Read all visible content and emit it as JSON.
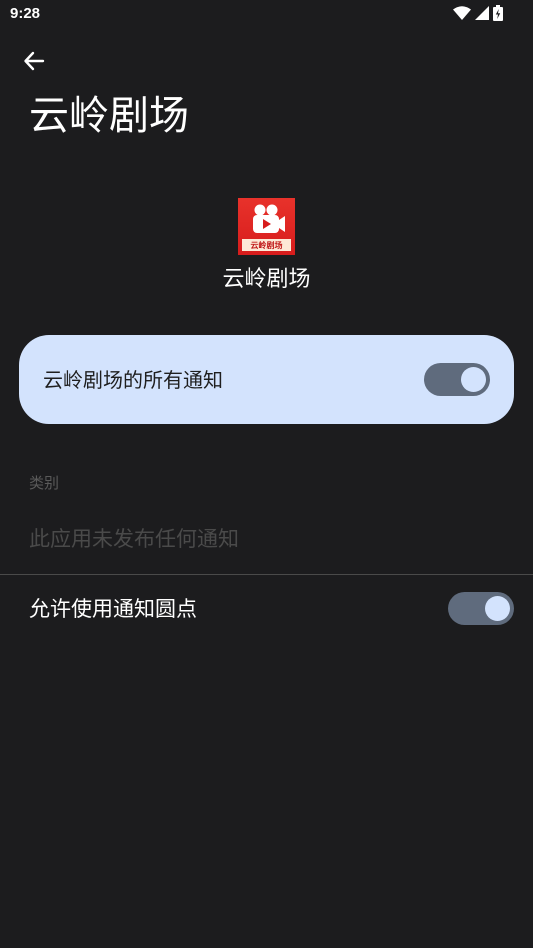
{
  "status_bar": {
    "time": "9:28",
    "icons": [
      "wifi-icon",
      "signal-icon",
      "battery-charging-icon"
    ]
  },
  "header": {
    "back_icon": "arrow-back-icon",
    "title": "云岭剧场"
  },
  "app": {
    "name": "云岭剧场",
    "icon_text": "云岭剧场",
    "icon_colors": {
      "background": "#d71c1c",
      "banner": "#fde9d6"
    }
  },
  "master_toggle": {
    "label": "云岭剧场的所有通知",
    "state": "on"
  },
  "categories": {
    "section_label": "类别",
    "empty_message": "此应用未发布任何通知"
  },
  "dots_toggle": {
    "label": "允许使用通知圆点",
    "state": "on"
  },
  "colors": {
    "background": "#1c1c1e",
    "card": "#d3e3fd",
    "switch_track": "#5f6b7d",
    "switch_thumb": "#d3e3fd"
  }
}
